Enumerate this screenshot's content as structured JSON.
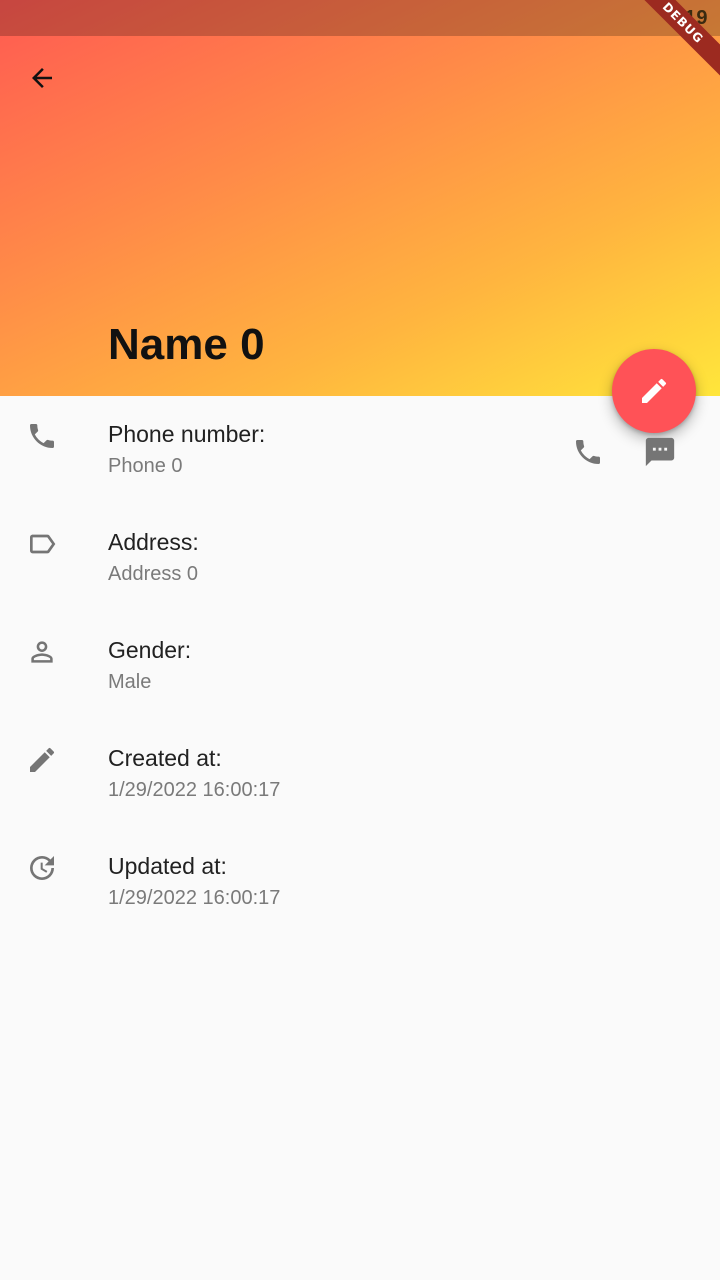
{
  "status_bar": {
    "time": "4:19"
  },
  "debug_banner": {
    "label": "DEBUG"
  },
  "header": {
    "back_icon": "arrow-back-icon",
    "title": "Name 0",
    "gradient": [
      "#ff5a52",
      "#ff8a48",
      "#ffb53f",
      "#ffe63b"
    ]
  },
  "fab": {
    "icon": "edit-icon",
    "color": "#ff5257"
  },
  "details": [
    {
      "icon": "phone-icon",
      "label": "Phone number:",
      "value": "Phone 0"
    },
    {
      "icon": "label-icon",
      "label": "Address:",
      "value": "Address 0"
    },
    {
      "icon": "person-icon",
      "label": "Gender:",
      "value": "Male"
    },
    {
      "icon": "edit-icon",
      "label": "Created at:",
      "value": "1/29/2022 16:00:17"
    },
    {
      "icon": "history-icon",
      "label": "Updated at:",
      "value": "1/29/2022 16:00:17"
    }
  ],
  "phone_actions": [
    {
      "icon": "call-icon"
    },
    {
      "icon": "message-icon"
    }
  ],
  "colors": {
    "icon_grey": "#757575",
    "label_text": "#212121",
    "value_text": "#7a7a7a",
    "background": "#fafafa"
  }
}
